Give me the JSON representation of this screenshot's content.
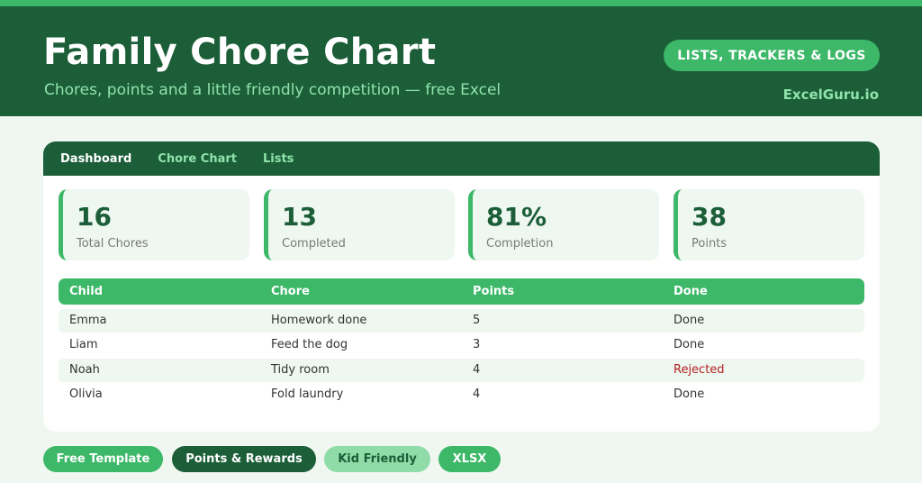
{
  "header": {
    "title": "Family Chore Chart",
    "subtitle": "Chores, points and a little friendly competition — free Excel",
    "category_pill": "LISTS, TRACKERS & LOGS",
    "brand": "ExcelGuru.io"
  },
  "tabs": [
    {
      "label": "Dashboard",
      "active": true
    },
    {
      "label": "Chore Chart",
      "active": false
    },
    {
      "label": "Lists",
      "active": false
    }
  ],
  "stats": [
    {
      "value": "16",
      "label": "Total Chores"
    },
    {
      "value": "13",
      "label": "Completed"
    },
    {
      "value": "81%",
      "label": "Completion"
    },
    {
      "value": "38",
      "label": "Points"
    }
  ],
  "table": {
    "columns": [
      "Child",
      "Chore",
      "Points",
      "Done"
    ],
    "rows": [
      [
        "Emma",
        "Homework done",
        "5",
        "Done"
      ],
      [
        "Liam",
        "Feed the dog",
        "3",
        "Done"
      ],
      [
        "Noah",
        "Tidy room",
        "4",
        "Rejected"
      ],
      [
        "Olivia",
        "Fold laundry",
        "4",
        "Done"
      ]
    ]
  },
  "tags": [
    "Free Template",
    "Points & Rewards",
    "Kid Friendly",
    "XLSX"
  ],
  "colors": {
    "accent": "#3cb868",
    "dark": "#1b5e38",
    "light_text": "#8fe3ab",
    "rejected": "#b22222"
  }
}
